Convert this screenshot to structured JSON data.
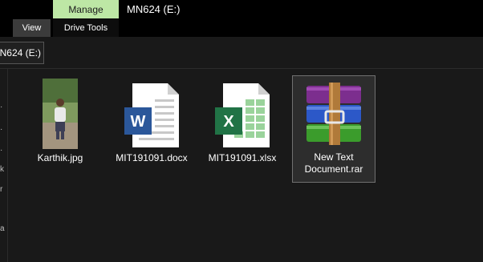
{
  "ribbon": {
    "manage_tab": "Manage",
    "title": "MN624 (E:)",
    "view_tab": "View",
    "drive_tools_tab": "Drive Tools"
  },
  "address": {
    "path": "MN624 (E:)"
  },
  "nav_pane": {
    "visible_chars": [
      "k",
      "r",
      "a"
    ]
  },
  "files": [
    {
      "name": "Karthik.jpg",
      "icon": "image-thumbnail-icon"
    },
    {
      "name": "MIT191091.docx",
      "icon": "word-document-icon"
    },
    {
      "name": "MIT191091.xlsx",
      "icon": "excel-document-icon"
    },
    {
      "name": "New Text Document.rar",
      "icon": "winrar-archive-icon",
      "selected": true
    }
  ],
  "colors": {
    "manage_tab": "#bde7a5",
    "word_blue": "#2b579a",
    "excel_green": "#217346",
    "background": "#191919"
  }
}
